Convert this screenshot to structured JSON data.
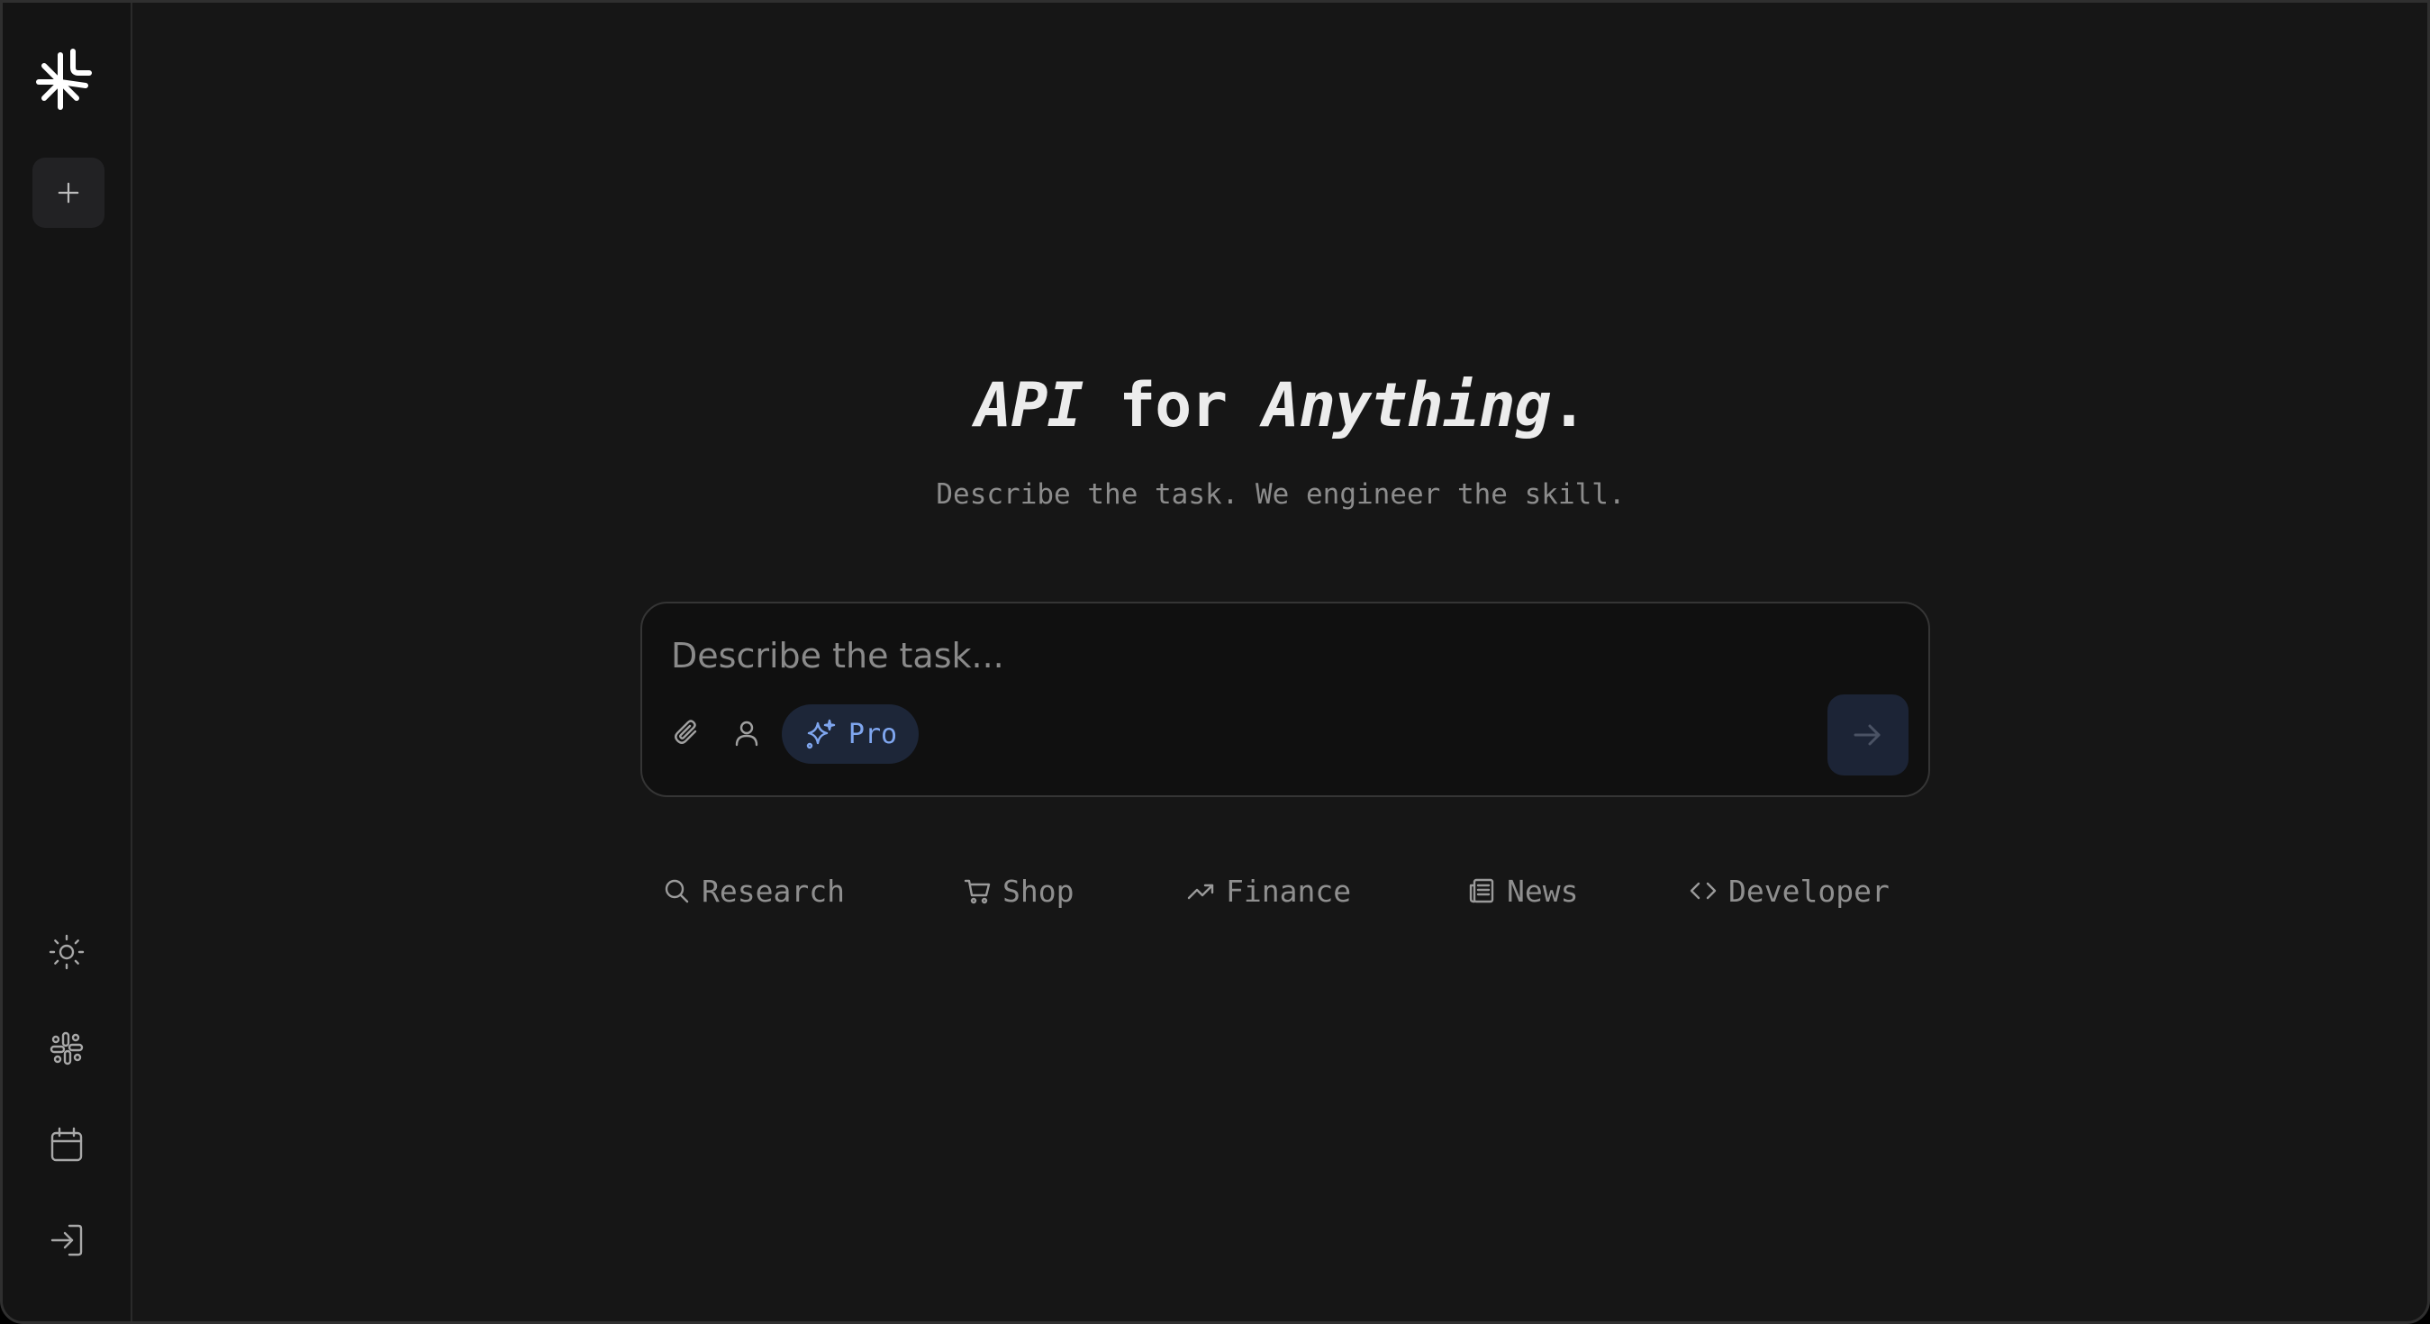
{
  "hero": {
    "title_part1": "API",
    "title_part2": " for ",
    "title_part3": "Anything",
    "title_part4": ".",
    "subtitle": "Describe the task. We engineer the skill."
  },
  "composer": {
    "placeholder": "Describe the task...",
    "pro_label": "Pro"
  },
  "categories": [
    {
      "label": "Research",
      "icon": "search-icon"
    },
    {
      "label": "Shop",
      "icon": "cart-icon"
    },
    {
      "label": "Finance",
      "icon": "trending-up-icon"
    },
    {
      "label": "News",
      "icon": "newspaper-icon"
    },
    {
      "label": "Developer",
      "icon": "code-icon"
    }
  ],
  "sidebar": {
    "icons": [
      "logo-icon",
      "plus-icon",
      "sun-icon",
      "slack-icon",
      "calendar-icon",
      "login-icon"
    ]
  },
  "colors": {
    "background": "#161616",
    "sidebar": "#141414",
    "accent": "#7fa6ef",
    "pro_pill_bg": "#1d2638",
    "muted_text": "#8f8f8f"
  }
}
